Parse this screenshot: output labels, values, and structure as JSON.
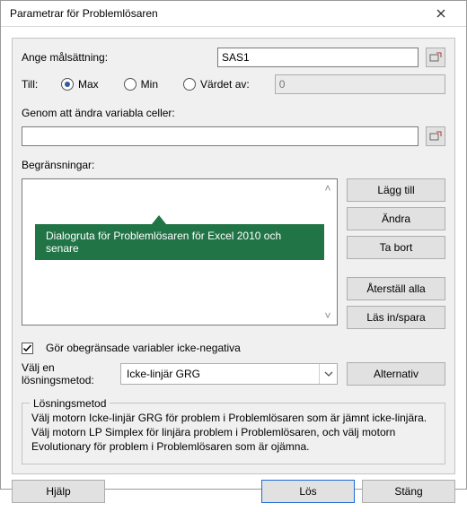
{
  "window": {
    "title": "Parametrar för Problemlösaren"
  },
  "labels": {
    "set_objective": "Ange målsättning:",
    "to": "Till:",
    "max": "Max",
    "min": "Min",
    "value_of": "Värdet av:",
    "by_changing": "Genom att ändra variabla celler:",
    "constraints": "Begränsningar:",
    "unbounded": "Gör obegränsade variabler icke-negativa",
    "method_label1": "Välj en",
    "method_label2": "lösningsmetod:",
    "groupbox_title": "Lösningsmetod",
    "groupbox_text": "Välj motorn Icke-linjär GRG för problem i Problemlösaren som är jämnt icke-linjära. Välj motorn LP Simplex för linjära problem i Problemlösaren, och välj motorn Evolutionary för problem i Problemlösaren som är ojämna."
  },
  "objective": {
    "value": "SAS1"
  },
  "to_section": {
    "selected": "max",
    "value_of_value": "0"
  },
  "by_changing": {
    "value": ""
  },
  "tooltip": {
    "text": "Dialogruta för Problemlösaren för Excel 2010 och senare"
  },
  "buttons": {
    "add": "Lägg till",
    "change": "Ändra",
    "delete": "Ta bort",
    "reset_all": "Återställ alla",
    "load_save": "Läs in/spara",
    "options": "Alternativ",
    "help": "Hjälp",
    "solve": "Lös",
    "close": "Stäng"
  },
  "unbounded_checkbox": {
    "checked": true
  },
  "method": {
    "selected": "Icke-linjär GRG"
  }
}
